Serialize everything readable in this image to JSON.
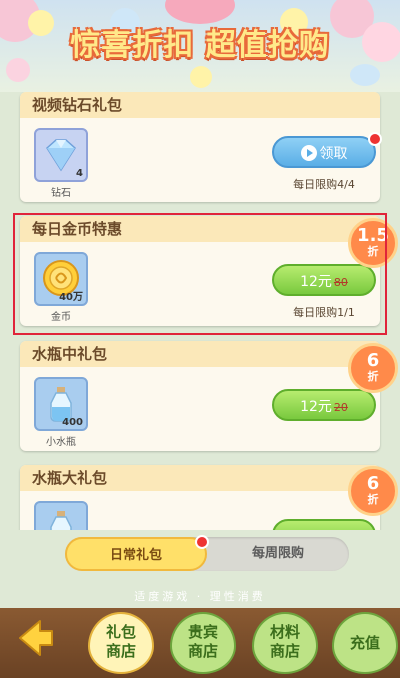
{
  "header": {
    "title": "惊喜折扣 超值抢购"
  },
  "packs": [
    {
      "title": "视频钻石礼包",
      "item_name": "钻石",
      "qty": "4",
      "icon": "diamond-icon",
      "button_label": "领取",
      "button_icon": "play-icon",
      "limit": "每日限购4/4",
      "has_dot": true
    },
    {
      "title": "每日金币特惠",
      "item_name": "金币",
      "qty": "40万",
      "icon": "gold-coin-icon",
      "price": "12元",
      "old_price": "80",
      "limit": "每日限购1/1",
      "discount_num": "1.5",
      "discount_unit": "折"
    },
    {
      "title": "水瓶中礼包",
      "item_name": "小水瓶",
      "qty": "400",
      "icon": "water-bottle-icon",
      "price": "12元",
      "old_price": "20",
      "discount_num": "6",
      "discount_unit": "折"
    },
    {
      "title": "水瓶大礼包",
      "icon": "water-bottle-icon",
      "discount_num": "6",
      "discount_unit": "折"
    }
  ],
  "tabs": {
    "daily": "日常礼包",
    "weekly": "每周限购"
  },
  "slogan": "适度游戏 · 理性消费",
  "nav": {
    "gift": [
      "礼包",
      "商店"
    ],
    "vip": [
      "贵宾",
      "商店"
    ],
    "material": [
      "材料",
      "商店"
    ],
    "recharge": "充值"
  },
  "colors": {
    "accent_orange": "#ff8a4a",
    "highlight_red": "#e0243a",
    "button_green": "#79c93e",
    "button_blue": "#5aaee6"
  }
}
